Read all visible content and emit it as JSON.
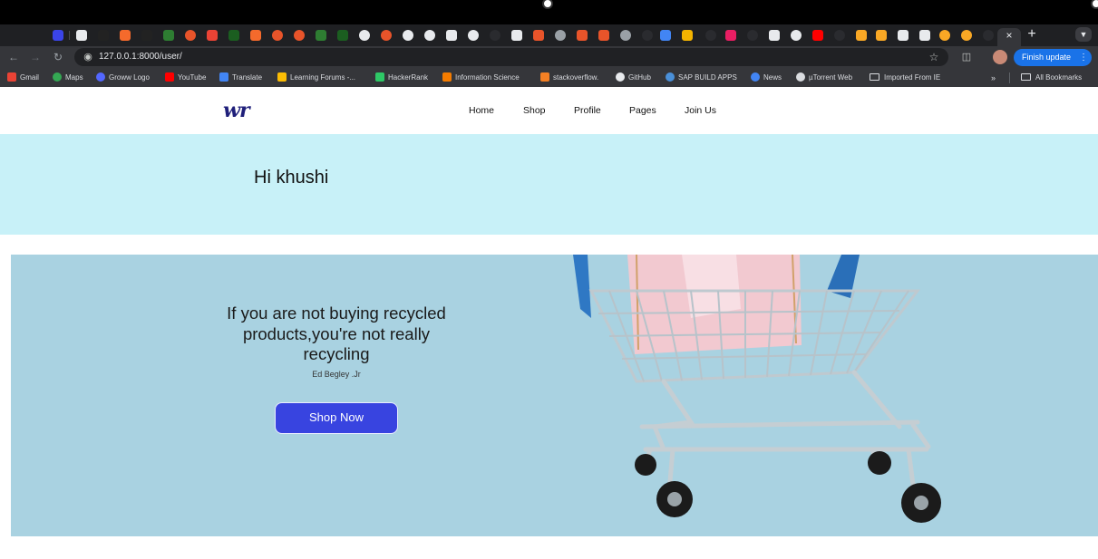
{
  "browser": {
    "url": "127.0.0.1:8000/user/",
    "finish_update": "Finish update",
    "tab_close": "×",
    "new_tab": "+"
  },
  "bookmarks": {
    "items": [
      "Gmail",
      "Maps",
      "Groww Logo",
      "YouTube",
      "Translate",
      "Learning Forums -...",
      "HackerRank",
      "Information Science",
      "stackoverflow.",
      "GitHub",
      "SAP BUILD APPS",
      "News",
      "µTorrent Web",
      "Imported From IE"
    ],
    "more": "»",
    "all_bookmarks": "All Bookmarks"
  },
  "site": {
    "logo": "wr",
    "nav": [
      "Home",
      "Shop",
      "Profile",
      "Pages",
      "Join Us"
    ],
    "greeting": "Hi khushi",
    "hero": {
      "quote_line1": "If you are not buying recycled",
      "quote_line2": "products,you're not really",
      "quote_line3": "recycling",
      "author": "Ed Begley .Jr",
      "cta": "Shop Now"
    }
  },
  "colors": {
    "accent": "#3844e0",
    "greeting_bg": "#c8f1f8",
    "hero_bg": "#a9d2e1"
  }
}
